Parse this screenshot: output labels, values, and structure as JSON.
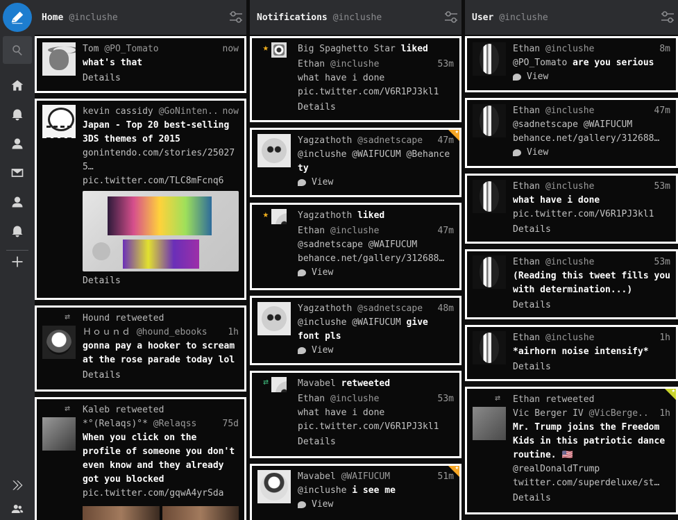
{
  "nav": {
    "icons": [
      "compose-icon",
      "search-icon",
      "home-icon",
      "notifications-icon",
      "user-icon",
      "messages-icon",
      "user-icon",
      "notifications-icon",
      "add-column-icon",
      "expand-icon",
      "accounts-icon"
    ]
  },
  "columns": [
    {
      "title": "Home",
      "user": "@inclushe",
      "cards": [
        {
          "name": "Tom",
          "handle": "@PO_Tomato",
          "time": "now",
          "text": "what's that",
          "details": "Details"
        },
        {
          "name": "kevin cassidy",
          "handle": "@GoNinten..",
          "time": "now",
          "text": "Japan - Top 20 best-selling 3DS themes of 2015",
          "link1": "gonintendo.com/stories/250275…",
          "link2": "pic.twitter.com/TLC8mFcnq6",
          "details": "Details"
        },
        {
          "retweeted_by": "Hound retweeted",
          "name": "Ｈｏｕｎｄ",
          "handle": "@hound_ebooks",
          "time": "1h",
          "text": "gonna pay a hooker to scream at the rose parade today lol",
          "details": "Details"
        },
        {
          "retweeted_by": "Kaleb retweeted",
          "name": "*°(Relaqs)°*",
          "handle": "@Relaqss",
          "time": "75d",
          "text": "When you click on the profile of someone you don't even know and they already got you blocked",
          "link": "pic.twitter.com/gqwA4yrSda"
        }
      ]
    },
    {
      "title": "Notifications",
      "user": "@inclushe",
      "cards": [
        {
          "actor": "Big Spaghetto Star",
          "action": "liked",
          "name": "Ethan",
          "handle": "@inclushe",
          "time": "53m",
          "text": "what have i done",
          "link": "pic.twitter.com/V6R1PJ3kl1",
          "details": "Details"
        },
        {
          "name": "Yagzathoth",
          "handle": "@sadnetscape",
          "time": "47m",
          "text_prefix": "@inclushe @WAIFUCUM @Behance",
          "text_bold": "ty",
          "view": "View"
        },
        {
          "actor": "Yagzathoth",
          "action": "liked",
          "name": "Ethan",
          "handle": "@inclushe",
          "time": "47m",
          "text": "@sadnetscape @WAIFUCUM",
          "link": "behance.net/gallery/312688…",
          "view": "View"
        },
        {
          "name": "Yagzathoth",
          "handle": "@sadnetscape",
          "time": "48m",
          "text_prefix": "@inclushe @WAIFUCUM",
          "text_bold": "give font pls",
          "view": "View"
        },
        {
          "actor": "Mavabel",
          "action": "retweeted",
          "name": "Ethan",
          "handle": "@inclushe",
          "time": "53m",
          "text": "what have i done",
          "link": "pic.twitter.com/V6R1PJ3kl1",
          "details": "Details"
        },
        {
          "name": "Mavabel",
          "handle": "@WAIFUCUM",
          "time": "51m",
          "text_prefix": "@inclushe",
          "text_bold": "i see me",
          "view": "View"
        }
      ]
    },
    {
      "title": "User",
      "user": "@inclushe",
      "cards": [
        {
          "name": "Ethan",
          "handle": "@inclushe",
          "time": "8m",
          "text_prefix": "@PO_Tomato",
          "text_bold": "are you serious",
          "view": "View"
        },
        {
          "name": "Ethan",
          "handle": "@inclushe",
          "time": "47m",
          "text": "@sadnetscape @WAIFUCUM",
          "link": "behance.net/gallery/312688…",
          "view": "View"
        },
        {
          "name": "Ethan",
          "handle": "@inclushe",
          "time": "53m",
          "text": "what have i done",
          "link": "pic.twitter.com/V6R1PJ3kl1",
          "details": "Details"
        },
        {
          "name": "Ethan",
          "handle": "@inclushe",
          "time": "53m",
          "text": "(Reading this tweet fills you with determination...)",
          "details": "Details"
        },
        {
          "name": "Ethan",
          "handle": "@inclushe",
          "time": "1h",
          "text": "*airhorn noise intensify*",
          "details": "Details"
        },
        {
          "retweeted_by": "Ethan retweeted",
          "name": "Vic Berger IV",
          "handle": "@VicBerge..",
          "time": "1h",
          "text": "Mr. Trump joins the Freedom Kids in this patriotic dance routine. 🇺🇸",
          "link1": "@realDonaldTrump",
          "link2": "twitter.com/superdeluxe/st…",
          "details": "Details"
        }
      ]
    }
  ]
}
